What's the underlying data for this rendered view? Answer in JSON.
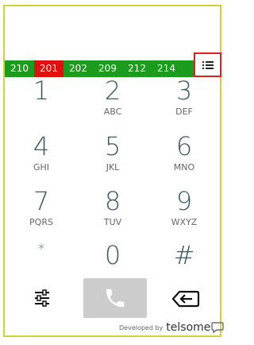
{
  "extensions": [
    {
      "label": "210",
      "status": "free"
    },
    {
      "label": "201",
      "status": "busy"
    },
    {
      "label": "202",
      "status": "free"
    },
    {
      "label": "209",
      "status": "free"
    },
    {
      "label": "212",
      "status": "free"
    },
    {
      "label": "214",
      "status": "free"
    }
  ],
  "keys": [
    {
      "digit": "1",
      "letters": ""
    },
    {
      "digit": "2",
      "letters": "ABC"
    },
    {
      "digit": "3",
      "letters": "DEF"
    },
    {
      "digit": "4",
      "letters": "GHI"
    },
    {
      "digit": "5",
      "letters": "JKL"
    },
    {
      "digit": "6",
      "letters": "MNO"
    },
    {
      "digit": "7",
      "letters": "PQRS"
    },
    {
      "digit": "8",
      "letters": "TUV"
    },
    {
      "digit": "9",
      "letters": "WXYZ"
    },
    {
      "digit": "*",
      "letters": ""
    },
    {
      "digit": "0",
      "letters": ""
    },
    {
      "digit": "#",
      "letters": ""
    }
  ],
  "footer": {
    "developed_by": "Developed by",
    "brand_main": "telsome",
    "brand_accent": ""
  },
  "colors": {
    "free": "#1c9c1c",
    "busy": "#e01010",
    "frame": "#d4d03a",
    "list_highlight": "#e02020",
    "call_button": "#cccccc",
    "digit": "#3e5a66"
  },
  "icons": {
    "list": "list-icon",
    "settings": "sliders-icon",
    "call": "phone-icon",
    "backspace": "backspace-icon"
  }
}
